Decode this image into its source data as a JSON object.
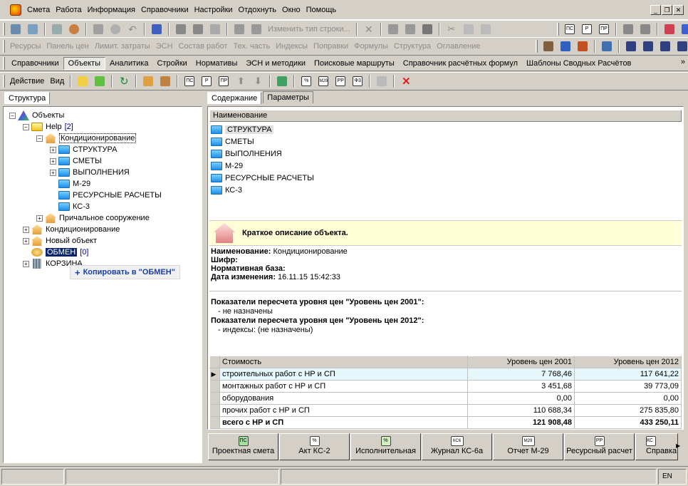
{
  "menu": {
    "items": [
      "Смета",
      "Работа",
      "Информация",
      "Справочники",
      "Настройки",
      "Отдохнуть",
      "Окно",
      "Помощь"
    ]
  },
  "toolbar1": {
    "change_type": "Изменить тип строки...",
    "badges": [
      "ПС",
      "Р",
      "ПР"
    ]
  },
  "toolbar2": {
    "items": [
      "Ресурсы",
      "Панель цен",
      "Лимит. затраты",
      "ЭСН",
      "Состав работ",
      "Тех. часть",
      "Индексы",
      "Поправки",
      "Формулы",
      "Структура",
      "Оглавление"
    ]
  },
  "tabs": {
    "items": [
      "Справочники",
      "Объекты",
      "Аналитика",
      "Стройки",
      "Нормативы",
      "ЭСН и методики",
      "Поисковые маршруты",
      "Справочник расчётных формул",
      "Шаблоны Сводных Расчётов"
    ],
    "active": 1
  },
  "toolbar3": {
    "action": "Действие",
    "view": "Вид",
    "badges": [
      "ПС",
      "Р",
      "ПР",
      "%",
      "М29",
      "РР",
      "Ф3"
    ]
  },
  "left": {
    "tab": "Структура"
  },
  "tree": {
    "root": "Объекты",
    "help": "Help",
    "help_count": "[2]",
    "cond": "Кондиционирование",
    "children": [
      "СТРУКТУРА",
      "СМЕТЫ",
      "ВЫПОЛНЕНИЯ",
      "М-29",
      "РЕСУРСНЫЕ РАСЧЕТЫ",
      "КС-3"
    ],
    "pier": "Причальное сооружение",
    "cond2": "Кондиционирование",
    "newobj": "Новый объект",
    "exchange": "ОБМЕН",
    "exchange_count": "[0]",
    "trash": "КОРЗИНА"
  },
  "drag_tip": "Копировать в \"ОБМЕН\"",
  "right_tabs": {
    "content": "Содержание",
    "params": "Параметры"
  },
  "list": {
    "header": "Наименование",
    "items": [
      "СТРУКТУРА",
      "СМЕТЫ",
      "ВЫПОЛНЕНИЯ",
      "М-29",
      "РЕСУРСНЫЕ РАСЧЕТЫ",
      "КС-3"
    ]
  },
  "desc": {
    "title": "Краткое описание объекта.",
    "name_label": "Наименование:",
    "name_value": "Кондиционирование",
    "code_label": "Шифр:",
    "base_label": "Нормативная база:",
    "date_label": "Дата изменения:",
    "date_value": "16.11.15 15:42:33"
  },
  "indicators": {
    "l2001": "Показатели пересчета уровня цен \"Уровень цен 2001\":",
    "v2001": "- не назначены",
    "l2012": "Показатели пересчета уровня цен \"Уровень цен 2012\":",
    "v2012": "- индексы: (не назначены)"
  },
  "costs": {
    "headers": [
      "Стоимость",
      "Уровень цен 2001",
      "Уровень цен 2012"
    ],
    "rows": [
      [
        "строительных работ с НР и СП",
        "7 768,46",
        "117 641,22"
      ],
      [
        "монтажных работ с НР и СП",
        "3 451,68",
        "39 773,09"
      ],
      [
        "оборудования",
        "0,00",
        "0,00"
      ],
      [
        "прочих работ с НР и СП",
        "110 688,34",
        "275 835,80"
      ],
      [
        "всего с НР и СП",
        "121 908,48",
        "433 250,11"
      ]
    ]
  },
  "bottom_buttons": [
    {
      "label": "Проектная смета",
      "icon": "ПС"
    },
    {
      "label": "Акт КС-2",
      "icon": "%"
    },
    {
      "label": "Исполнительная",
      "icon": "%"
    },
    {
      "label": "Журнал КС-6а",
      "icon": "КС6"
    },
    {
      "label": "Отчет М-29",
      "icon": "М29"
    },
    {
      "label": "Ресурсный расчет",
      "icon": "РР"
    },
    {
      "label": "Справка",
      "icon": "КС"
    }
  ],
  "status": {
    "lang": "EN"
  }
}
